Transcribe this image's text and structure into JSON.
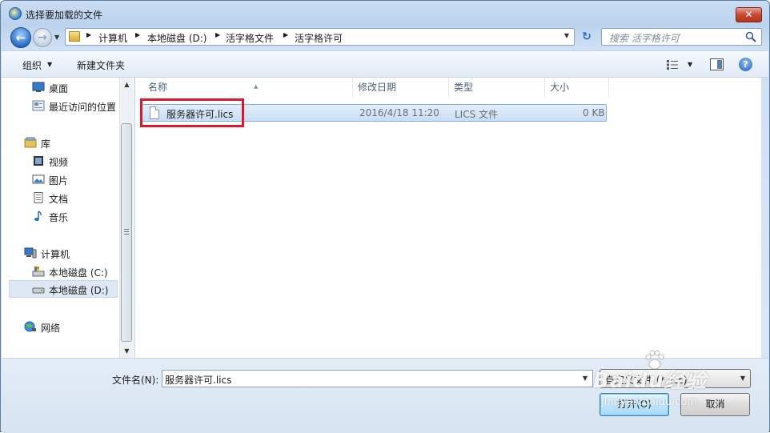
{
  "window": {
    "title": "选择要加载的文件",
    "close_label": "✕"
  },
  "navigation": {
    "breadcrumbs": [
      "计算机",
      "本地磁盘 (D:)",
      "活字格文件",
      "活字格许可"
    ],
    "search_placeholder": "搜索 活字格许可"
  },
  "toolbar": {
    "organize_label": "组织",
    "new_folder_label": "新建文件夹",
    "help_label": "?"
  },
  "sidebar": {
    "items": [
      {
        "label": "桌面",
        "icon": "desktop-icon"
      },
      {
        "label": "最近访问的位置",
        "icon": "recent-places-icon"
      },
      {
        "label": "库",
        "icon": "library-icon"
      },
      {
        "label": "视频",
        "icon": "video-icon"
      },
      {
        "label": "图片",
        "icon": "picture-icon"
      },
      {
        "label": "文档",
        "icon": "document-icon"
      },
      {
        "label": "音乐",
        "icon": "music-icon"
      },
      {
        "label": "计算机",
        "icon": "computer-icon"
      },
      {
        "label": "本地磁盘 (C:)",
        "icon": "drive-c-icon"
      },
      {
        "label": "本地磁盘 (D:)",
        "icon": "drive-d-icon",
        "selected": true
      },
      {
        "label": "网络",
        "icon": "network-icon"
      }
    ]
  },
  "file_list": {
    "columns": [
      "名称",
      "修改日期",
      "类型",
      "大小"
    ],
    "rows": [
      {
        "name": "服务器许可.lics",
        "modified": "2016/4/18 11:20",
        "type": "LICS 文件",
        "size": "0 KB",
        "selected": true
      }
    ]
  },
  "footer": {
    "filename_label": "文件名(N):",
    "filename_value": "服务器许可.lics",
    "filetype_value": "自定义文件 (*.lics)",
    "open_label": "打开(O)",
    "cancel_label": "取消"
  },
  "watermark": {
    "logo": "Baidu经验",
    "url": "jingyan.baidu.com"
  },
  "colors": {
    "highlight_box": "#e0162b",
    "selection": "#c9ddf4",
    "window_frame": "#bcd3ee"
  }
}
